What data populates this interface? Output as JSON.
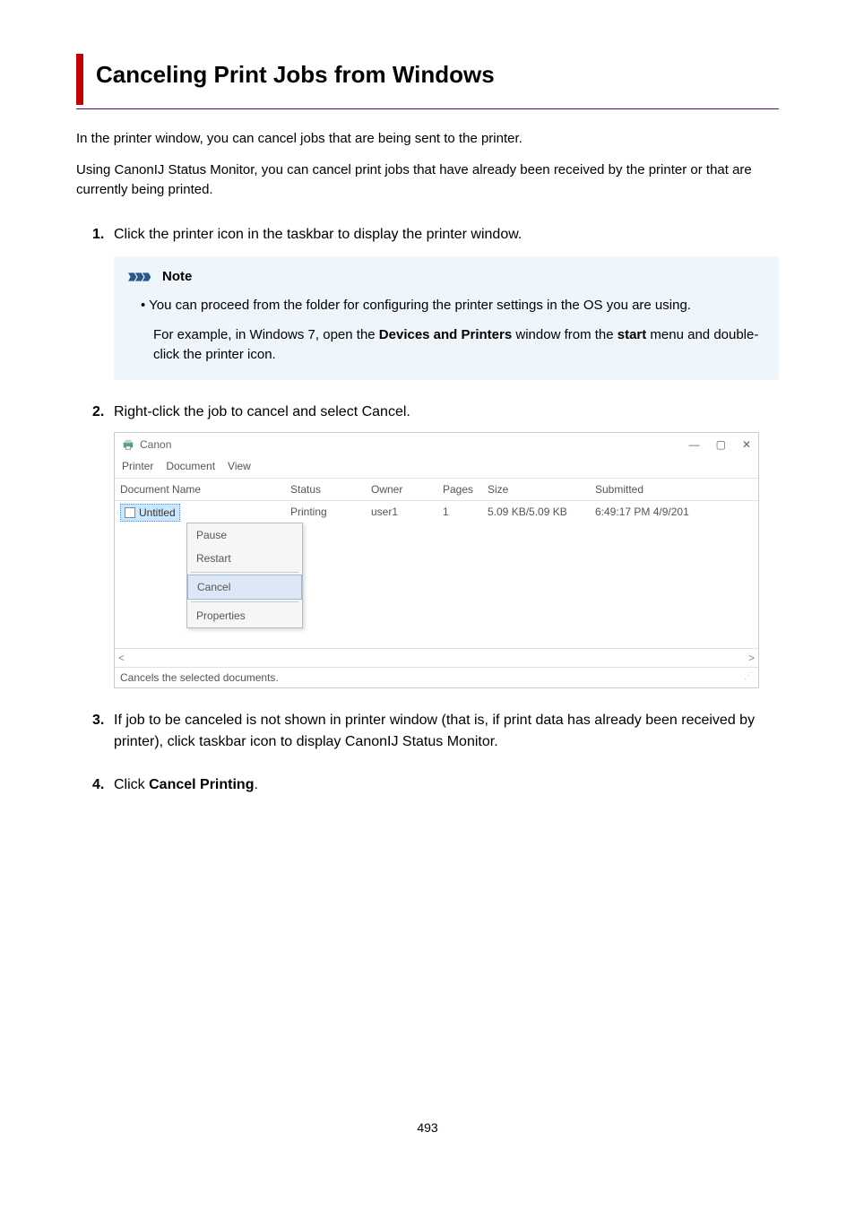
{
  "title": "Canceling Print Jobs from Windows",
  "intro1": "In the printer window, you can cancel jobs that are being sent to the printer.",
  "intro2": "Using CanonIJ Status Monitor, you can cancel print jobs that have already been received by the printer or that are currently being printed.",
  "steps": {
    "s1": {
      "num": "1.",
      "text": "Click the printer icon in the taskbar to display the printer window."
    },
    "s2": {
      "num": "2.",
      "text": "Right-click the job to cancel and select Cancel."
    },
    "s3": {
      "num": "3.",
      "text": "If job to be canceled is not shown in printer window (that is, if print data has already been received by printer), click taskbar icon to display CanonIJ Status Monitor."
    },
    "s4": {
      "num": "4.",
      "prefix": "Click ",
      "bold": "Cancel Printing",
      "suffix": "."
    }
  },
  "note": {
    "title": "Note",
    "bullet": "You can proceed from the folder for configuring the printer settings in the OS you are using.",
    "sub_before": "For example, in Windows 7, open the ",
    "sub_b1": "Devices and Printers",
    "sub_mid": " window from the ",
    "sub_b2": "start",
    "sub_after": " menu and double-click the printer icon."
  },
  "printer_window": {
    "title": "Canon",
    "controls": {
      "min": "—",
      "max": "▢",
      "close": "✕"
    },
    "menu": {
      "printer": "Printer",
      "document": "Document",
      "view": "View"
    },
    "headers": {
      "docname": "Document Name",
      "status": "Status",
      "owner": "Owner",
      "pages": "Pages",
      "size": "Size",
      "submitted": "Submitted"
    },
    "row": {
      "name": "Untitled",
      "status": "Printing",
      "owner": "user1",
      "pages": "1",
      "size": "5.09 KB/5.09 KB",
      "submitted": "6:49:17 PM  4/9/201"
    },
    "context": {
      "pause": "Pause",
      "restart": "Restart",
      "cancel": "Cancel",
      "properties": "Properties"
    },
    "scroll": {
      "left": "<",
      "right": ">"
    },
    "statusbar": "Cancels the selected documents."
  },
  "page_number": "493"
}
